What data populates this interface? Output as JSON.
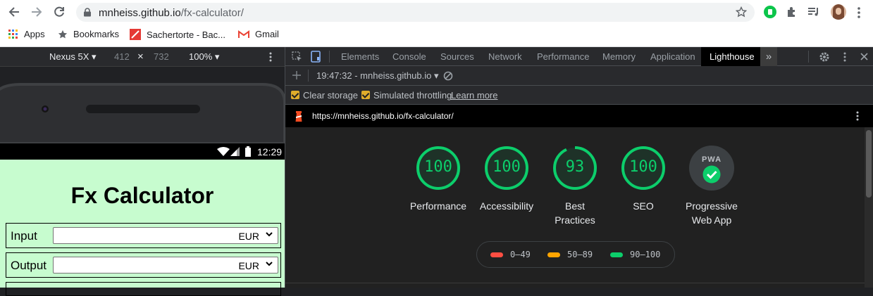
{
  "browser": {
    "url_host": "mnheiss.github.io",
    "url_path": "/fx-calculator/",
    "bookmarks": [
      {
        "label": "Apps",
        "icon": "apps-grid-icon"
      },
      {
        "label": "Bookmarks",
        "icon": "star-icon"
      },
      {
        "label": "Sachertorte - Bac...",
        "icon": "recipe-icon"
      },
      {
        "label": "Gmail",
        "icon": "gmail-icon"
      }
    ]
  },
  "device_toolbar": {
    "device": "Nexus 5X",
    "width": "412",
    "times": "×",
    "height": "732",
    "zoom": "100%"
  },
  "phone": {
    "status_time": "12:29"
  },
  "app": {
    "title": "Fx Calculator",
    "rows": [
      {
        "label": "Input",
        "currency": "EUR"
      },
      {
        "label": "Output",
        "currency": "EUR"
      }
    ]
  },
  "devtools": {
    "tabs": [
      "Elements",
      "Console",
      "Sources",
      "Network",
      "Performance",
      "Memory",
      "Application",
      "Lighthouse"
    ],
    "active_tab": "Lighthouse",
    "more": "»",
    "report_select": "19:47:32 - mnheiss.github.io",
    "clear_storage": "Clear storage",
    "simulated_throttling": "Simulated throttling",
    "learn_more": "Learn more",
    "report_url": "https://mnheiss.github.io/fx-calculator/"
  },
  "lighthouse": {
    "scores": [
      {
        "value": 100,
        "label": "Performance"
      },
      {
        "value": 100,
        "label": "Accessibility"
      },
      {
        "value": 93,
        "label": "Best\nPractices"
      },
      {
        "value": 100,
        "label": "SEO"
      }
    ],
    "pwa": {
      "badge": "PWA",
      "label": "Progressive\nWeb App"
    },
    "legend": [
      {
        "range": "0–49",
        "color": "#ff4e42"
      },
      {
        "range": "50–89",
        "color": "#ffa400"
      },
      {
        "range": "90–100",
        "color": "#0cce6b"
      }
    ],
    "color_pass": "#0cce6b"
  }
}
